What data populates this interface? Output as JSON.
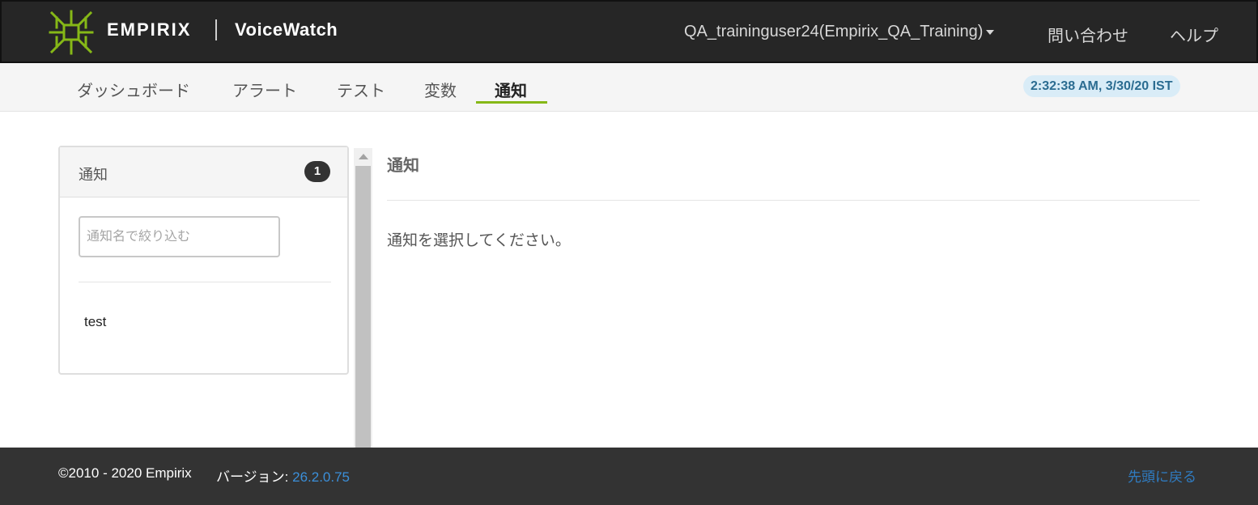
{
  "header": {
    "brand": "EMPIRIX",
    "product": "VoiceWatch",
    "user": "QA_traininguser24(Empirix_QA_Training)",
    "contact": "問い合わせ",
    "help": "ヘルプ"
  },
  "nav": {
    "tabs": [
      {
        "label": "ダッシュボード"
      },
      {
        "label": "アラート"
      },
      {
        "label": "テスト"
      },
      {
        "label": "変数"
      },
      {
        "label": "通知",
        "active": true
      }
    ],
    "clock": "2:32:38 AM, 3/30/20 IST"
  },
  "sidebar": {
    "title": "通知",
    "count": "1",
    "filter_placeholder": "通知名で絞り込む",
    "items": [
      {
        "label": "test"
      }
    ]
  },
  "main": {
    "title": "通知",
    "message": "通知を選択してください。"
  },
  "footer": {
    "copyright": "©2010 - 2020 Empirix",
    "version_label": "バージョン: ",
    "version": "26.2.0.75",
    "back_to_top": "先頭に戻る"
  },
  "colors": {
    "topbar": "#262626",
    "accent_green": "#86b817",
    "clock_bg": "#d9ecf7",
    "clock_text": "#2b6c91",
    "footer": "#333333",
    "link": "#3b8fd9"
  }
}
